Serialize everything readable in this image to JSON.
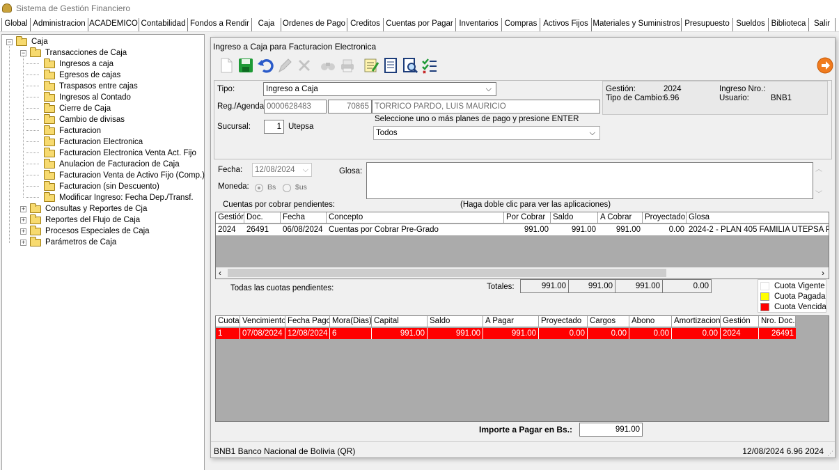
{
  "app": {
    "title": "Sistema de Gestión Financiero"
  },
  "menu": [
    "Global",
    "Administracion",
    "ACADEMICO",
    "Contabilidad",
    "Fondos a Rendir",
    "Caja",
    "Ordenes de Pago",
    "Creditos",
    "Cuentas por Pagar",
    "Inventarios",
    "Compras",
    "Activos Fijos",
    "Materiales y Suministros",
    "Presupuesto",
    "Sueldos",
    "Biblioteca",
    "Salir"
  ],
  "menu_active": "Caja",
  "tree": {
    "root": "Caja",
    "group": "Transacciones de Caja",
    "items": [
      "Ingresos a caja",
      "Egresos de cajas",
      "Traspasos entre cajas",
      "Ingresos al Contado",
      "Cierre de Caja",
      "Cambio de divisas",
      "Facturacion",
      "Facturacion Electronica",
      "Facturacion Electronica Venta Act. Fijo",
      "Anulacion de Facturacion de Caja",
      "Facturacion Venta de Activo Fijo (Comp.)",
      "Facturacion (sin Descuento)",
      "Modificar Ingreso: Fecha Dep./Transf."
    ],
    "others": [
      "Consultas y Reportes de Cja",
      "Reportes del Flujo de Caja",
      "Procesos Especiales de Caja",
      "Parámetros de Caja"
    ]
  },
  "form": {
    "title": "Ingreso a Caja para Facturacion Electronica",
    "tipo_label": "Tipo:",
    "tipo_value": "Ingreso a Caja",
    "reg_label": "Reg./Agenda:",
    "reg_value": "0000628483",
    "code_value": "70865",
    "name_value": "TORRICO PARDO, LUIS MAURICIO",
    "sucursal_label": "Sucursal:",
    "sucursal_num": "1",
    "sucursal_name": "Utepsa",
    "planes_hint": "Seleccione uno o más planes de pago y presione ENTER",
    "planes_value": "Todos",
    "info": {
      "gestion_label": "Gestión:",
      "gestion_value": "2024",
      "tipo_cambio_label": "Tipo de Cambio:",
      "tipo_cambio_value": "6.96",
      "ingreso_label": "Ingreso Nro.:",
      "ingreso_value": "",
      "usuario_label": "Usuario:",
      "usuario_value": "BNB1"
    },
    "fecha_label": "Fecha:",
    "fecha_value": "12/08/2024",
    "glosa_label": "Glosa:",
    "glosa_value": "",
    "moneda_label": "Moneda:",
    "moneda_options": [
      "Bs",
      "$us"
    ],
    "moneda_selected": "Bs"
  },
  "pendientes": {
    "title": "Cuentas por cobrar pendientes:",
    "hint": "(Haga doble clic para ver las aplicaciones)",
    "headers": [
      "Gestión",
      "Doc.",
      "Fecha",
      "Concepto",
      "Por Cobrar",
      "Saldo",
      "A Cobrar",
      "Proyectado",
      "Glosa"
    ],
    "rows": [
      [
        "2024",
        "26491",
        "06/08/2024",
        "Cuentas por Cobrar Pre-Grado",
        "991.00",
        "991.00",
        "991.00",
        "0.00",
        "2024-2 - PLAN 405 FAMILIA UTEPSA P"
      ]
    ]
  },
  "totales": {
    "todas_label": "Todas las cuotas pendientes:",
    "label": "Totales:",
    "values": [
      "991.00",
      "991.00",
      "991.00",
      "0.00"
    ]
  },
  "legend": [
    {
      "label": "Cuota Vigente",
      "color": "#ffffff"
    },
    {
      "label": "Cuota Pagada",
      "color": "#ffff00"
    },
    {
      "label": "Cuota Vencida",
      "color": "#ff0000"
    }
  ],
  "cuotas": {
    "headers": [
      "Cuota",
      "Vencimiento",
      "Fecha Pago",
      "Mora(Dias)",
      "Capital",
      "Saldo",
      "A Pagar",
      "Proyectado",
      "Cargos",
      "Abono",
      "Amortizacion",
      "Gestión",
      "Nro. Doc."
    ],
    "rows": [
      [
        "1",
        "07/08/2024",
        "12/08/2024",
        "6",
        "991.00",
        "991.00",
        "991.00",
        "0.00",
        "0.00",
        "0.00",
        "0.00",
        "2024",
        "26491"
      ]
    ]
  },
  "importe": {
    "label": "Importe a Pagar en Bs.:",
    "value": "991.00"
  },
  "status": {
    "left": "BNB1  Banco Nacional de Bolivia (QR)",
    "right": "12/08/2024  6.96  2024"
  }
}
